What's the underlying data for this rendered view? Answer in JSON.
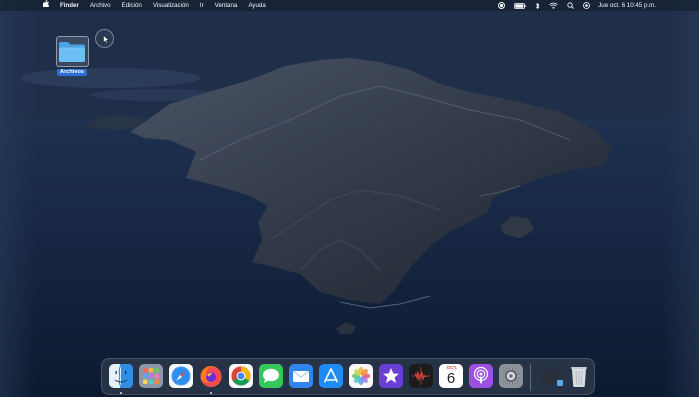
{
  "menubar": {
    "apple_icon": "apple-logo-icon",
    "app_name": "Finder",
    "items": [
      "Archivo",
      "Edición",
      "Visualización",
      "Ir",
      "Ventana",
      "Ayuda"
    ],
    "status_icons": [
      "screen-record-icon",
      "battery-icon",
      "bluetooth-icon",
      "wifi-icon",
      "spotlight-icon",
      "control-center-icon"
    ],
    "clock": "Jue oct. 6  10:45 p.m."
  },
  "desktop": {
    "folder_label": "Archivos",
    "folder_icon": "folder-icon"
  },
  "dock": {
    "apps": [
      "Finder",
      "Launchpad",
      "Safari",
      "Firefox",
      "Google Chrome",
      "Mensajes",
      "Mail",
      "App Store",
      "Fotos",
      "iMovie",
      "Grabadora",
      "Calendario",
      "Podcasts",
      "Preferencias del Sistema",
      "Descargas",
      "Papelera"
    ],
    "calendar_month": "OCT.",
    "calendar_day": "6",
    "running": [
      "Finder",
      "Firefox"
    ]
  },
  "colors": {
    "folder_blue": "#5fb6f2",
    "selection_blue": "#2d6fd6",
    "calendar_red": "#e2453c"
  }
}
